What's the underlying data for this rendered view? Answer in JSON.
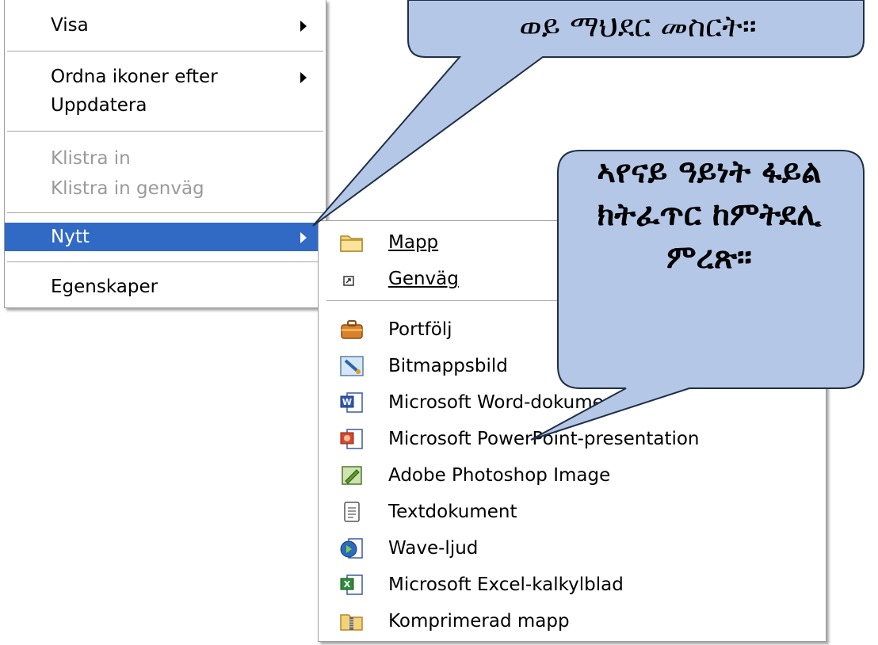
{
  "context_menu": {
    "items": [
      {
        "label": "Visa",
        "submenu": true,
        "disabled": false
      },
      {
        "label": "Ordna ikoner efter",
        "submenu": true,
        "disabled": false
      },
      {
        "label": "Uppdatera",
        "submenu": false,
        "disabled": false
      },
      {
        "label": "Klistra in",
        "submenu": false,
        "disabled": true
      },
      {
        "label": "Klistra in genväg",
        "submenu": false,
        "disabled": true
      },
      {
        "label": "Nytt",
        "submenu": true,
        "disabled": false,
        "selected": true
      },
      {
        "label": "Egenskaper",
        "submenu": false,
        "disabled": false
      }
    ]
  },
  "submenu": {
    "items": [
      {
        "label": "Mapp",
        "icon": "folder-icon"
      },
      {
        "label": "Genväg",
        "icon": "shortcut-icon"
      },
      {
        "label": "Portfölj",
        "icon": "briefcase-icon"
      },
      {
        "label": "Bitmappsbild",
        "icon": "paint-icon"
      },
      {
        "label": "Microsoft Word-dokument",
        "icon": "word-icon"
      },
      {
        "label": "Microsoft PowerPoint-presentation",
        "icon": "powerpoint-icon"
      },
      {
        "label": "Adobe Photoshop Image",
        "icon": "photoshop-icon"
      },
      {
        "label": "Textdokument",
        "icon": "text-file-icon"
      },
      {
        "label": "Wave-ljud",
        "icon": "wave-audio-icon"
      },
      {
        "label": "Microsoft Excel-kalkylblad",
        "icon": "excel-icon"
      },
      {
        "label": "Komprimerad mapp",
        "icon": "zip-folder-icon"
      }
    ]
  },
  "callouts": {
    "top": "ወይ ማህደር መስርት።",
    "right": "ኣየናይ ዓይነት ፋይል ክትፈጥር ከምትደሊ ምረጽ።"
  },
  "colors": {
    "selection": "#316ac5",
    "callout_fill": "#b4c7e7",
    "callout_stroke": "#1f2f46"
  }
}
